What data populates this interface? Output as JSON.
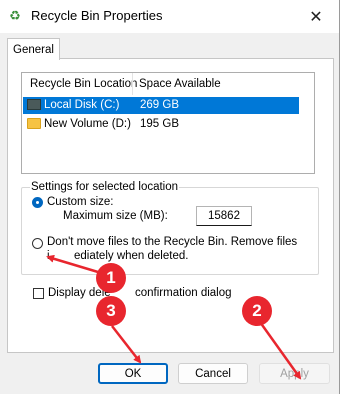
{
  "window": {
    "title": "Recycle Bin Properties",
    "close_glyph": "✕",
    "title_icon": "recycle-icon"
  },
  "tabs": [
    {
      "label": "General",
      "active": true
    }
  ],
  "location_list": {
    "columns": [
      "Recycle Bin Location",
      "Space Available"
    ],
    "rows": [
      {
        "name": "Local Disk (C:)",
        "space": "269 GB",
        "selected": true,
        "icon": "drive-icon"
      },
      {
        "name": "New Volume (D:)",
        "space": "195 GB",
        "selected": false,
        "icon": "folder-icon"
      }
    ]
  },
  "settings": {
    "group_title": "Settings for selected location",
    "custom_size_label": "Custom size:",
    "max_size_label": "Maximum size (MB):",
    "max_size_value": "15862",
    "dont_move_label_1": "Don't move files to the Recycle Bin. Remove files",
    "dont_move_label_2_start": "i",
    "dont_move_label_2_end": "ediately when deleted.",
    "display_confirm_start": "Display dele",
    "display_confirm_end": " confirmation dialog",
    "custom_size_selected": true,
    "display_confirm_checked": false
  },
  "buttons": {
    "ok": "OK",
    "cancel": "Cancel",
    "apply": "Apply",
    "apply_enabled": false
  },
  "annotations": [
    {
      "number": "1",
      "color": "#e8262e"
    },
    {
      "number": "2",
      "color": "#e8262e"
    },
    {
      "number": "3",
      "color": "#e8262e"
    }
  ],
  "colors": {
    "selection": "#0078d7",
    "accent": "#0067c0",
    "annotation": "#e8262e"
  }
}
